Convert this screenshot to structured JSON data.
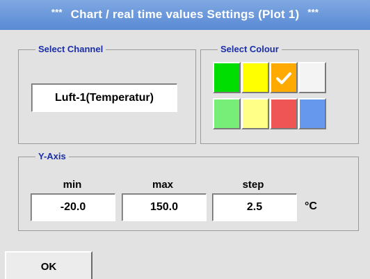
{
  "title": {
    "stars_left": "***",
    "text": "Chart / real time values Settings (Plot 1)",
    "stars_right": "***"
  },
  "select_channel": {
    "label": "Select Channel",
    "value": "Luft-1(Temperatur)"
  },
  "select_colour": {
    "label": "Select Colour",
    "selected_index": 2,
    "swatches": [
      {
        "color": "#00dd00"
      },
      {
        "color": "#ffff00"
      },
      {
        "color": "#ffaa00",
        "icon": "check-icon"
      },
      {
        "color": "#f4f4f4"
      },
      {
        "color": "#77ee77"
      },
      {
        "color": "#ffff88"
      },
      {
        "color": "#f05555"
      },
      {
        "color": "#6699ee"
      }
    ]
  },
  "y_axis": {
    "label": "Y-Axis",
    "min_label": "min",
    "max_label": "max",
    "step_label": "step",
    "min_value": "-20.0",
    "max_value": "150.0",
    "step_value": "2.5",
    "unit": "°C"
  },
  "buttons": {
    "ok_label": "OK"
  }
}
